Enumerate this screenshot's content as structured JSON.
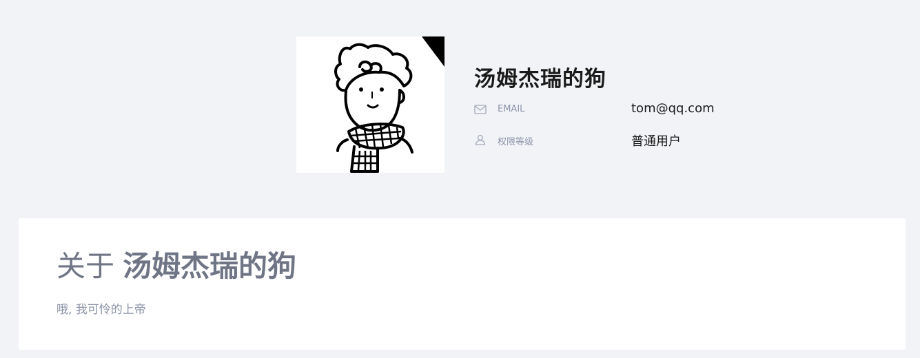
{
  "profile": {
    "name": "汤姆杰瑞的狗",
    "avatar_icon": "hand-drawn-boy-with-scarf",
    "fields": {
      "email": {
        "icon": "mail-icon",
        "label": "EMAIL",
        "value": "tom@qq.com"
      },
      "role": {
        "icon": "user-icon",
        "label": "权限等级",
        "value": "普通用户"
      }
    }
  },
  "about": {
    "prefix": "关于",
    "name": "汤姆杰瑞的狗",
    "bio": "哦, 我可怜的上帝"
  },
  "colors": {
    "page_background": "#f2f3f7",
    "card_background": "#ffffff",
    "title_text": "#1a1a1a",
    "muted_text": "#8c93a8",
    "about_title": "#6f7585"
  }
}
